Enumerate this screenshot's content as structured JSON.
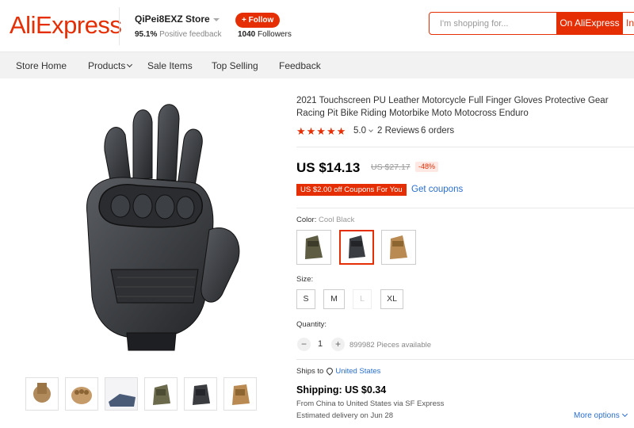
{
  "header": {
    "logo": "AliExpress",
    "store_name": "QiPei8EXZ Store",
    "positive_pct": "95.1%",
    "positive_text": "Positive feedback",
    "follow_label": "+ Follow",
    "followers_count": "1040",
    "followers_text": "Followers",
    "search_placeholder": "I'm shopping for...",
    "search_button": "On AliExpress",
    "search_button2": "In"
  },
  "nav": {
    "items": [
      "Store Home",
      "Products",
      "Sale Items",
      "Top Selling",
      "Feedback"
    ]
  },
  "product": {
    "title": "2021 Touchscreen PU Leather Motorcycle Full Finger Gloves Protective Gear Racing Pit Bike Riding Motorbike Moto Motocross Enduro",
    "stars": "★★★★★",
    "rating_value": "5.0",
    "reviews": "2 Reviews",
    "orders": "6 orders",
    "price": "US $14.13",
    "original_price": "US $27.17",
    "discount": "-48%",
    "coupon": "US $2.00 off Coupons For You",
    "get_coupons": "Get coupons",
    "color_label": "Color:",
    "color_selected": "Cool Black",
    "size_label": "Size:",
    "sizes": [
      "S",
      "M",
      "L",
      "XL"
    ],
    "quantity_label": "Quantity:",
    "qty_minus": "−",
    "qty_plus": "+",
    "quantity": "1",
    "available": "899982 Pieces available",
    "ships_to_label": "Ships to",
    "ships_to": "United States",
    "shipping": "Shipping: US $0.34",
    "from": "From China to United States via SF Express",
    "estimated": "Estimated delivery on Jun 28",
    "more_options": "More options"
  },
  "colors": {
    "accent": "#e62e04",
    "link": "#2a6ed0"
  }
}
